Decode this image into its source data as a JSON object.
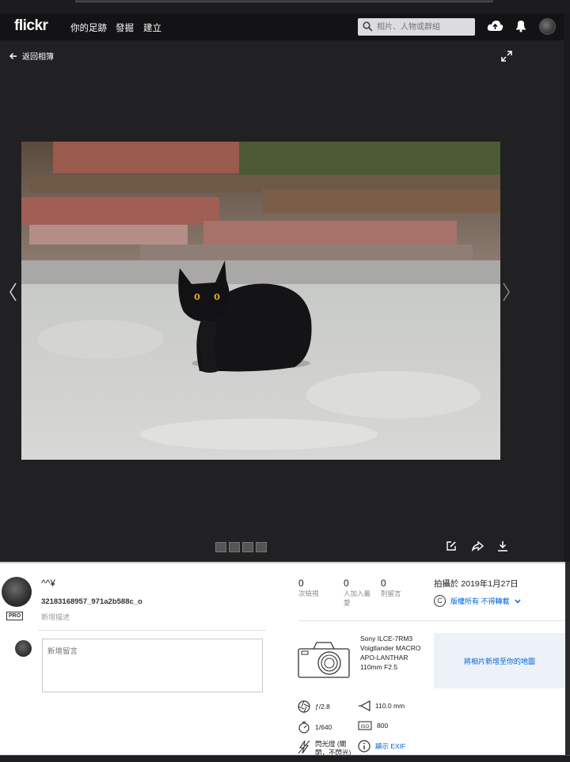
{
  "nav": {
    "logo": "flickr",
    "links": [
      "你的足跡",
      "發掘",
      "建立"
    ],
    "search_placeholder": "相片、人物或群組"
  },
  "viewer": {
    "back_label": "返回相簿",
    "thumbnail_count": 4
  },
  "owner": {
    "name": "^^¥",
    "pro_badge": "PRO",
    "photo_title": "32183168957_971a2b588c_o",
    "add_description": "新增描述"
  },
  "comment": {
    "placeholder": "新增留言"
  },
  "stats": [
    {
      "value": "0",
      "label": "次檢視"
    },
    {
      "value": "0",
      "label": "人加入最愛"
    },
    {
      "value": "0",
      "label": "則留言"
    }
  ],
  "taken": "拍攝於 2019年1月27日",
  "license": {
    "symbol": "C",
    "label": "版權所有 不得轉載"
  },
  "camera": {
    "model": "Sony ILCE-7RM3",
    "lens": "Voigtlander MACRO APO-LANTHAR 110mm F2.5"
  },
  "map_label": "將相片新增至你的地圖",
  "exif": {
    "aperture": "ƒ/2.8",
    "focal_length": "110.0 mm",
    "shutter": "1/640",
    "iso": "800",
    "flash": "閃光燈 (關閉，不閃光)",
    "show_exif": "顯示 EXIF"
  }
}
